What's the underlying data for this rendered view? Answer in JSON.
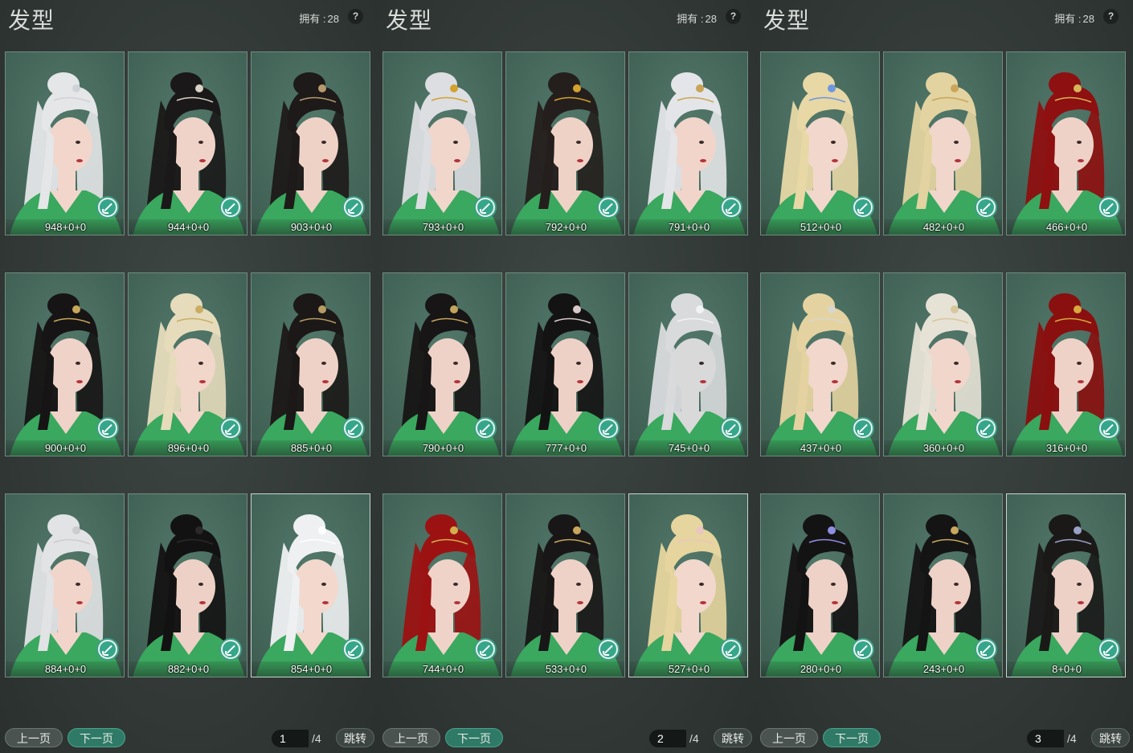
{
  "panels": [
    {
      "title": "发型",
      "owned_label": "拥有 :",
      "owned_count": "28",
      "help": "?",
      "prev_label": "上一页",
      "next_label": "下一页",
      "page": "1",
      "total": "/4",
      "jump_label": "跳转",
      "cards": [
        {
          "price": "948+0+0",
          "hair": "#e4e6e8",
          "skin": "#f2d6cb",
          "accent": "#cfd3d6"
        },
        {
          "price": "944+0+0",
          "hair": "#1a1818",
          "skin": "#f0d3c8",
          "accent": "#d7d2c4"
        },
        {
          "price": "903+0+0",
          "hair": "#1d1a19",
          "skin": "#efd2c6",
          "accent": "#b49a6e"
        },
        {
          "price": "900+0+0",
          "hair": "#161414",
          "skin": "#efd3c8",
          "accent": "#c7a85a"
        },
        {
          "price": "896+0+0",
          "hair": "#e6dcbc",
          "skin": "#f1d6ca",
          "accent": "#c9ad66"
        },
        {
          "price": "885+0+0",
          "hair": "#1b1817",
          "skin": "#efd2c7",
          "accent": "#b69b62"
        },
        {
          "price": "884+0+0",
          "hair": "#e2e3e5",
          "skin": "#f1d5cb",
          "accent": "#cccccc"
        },
        {
          "price": "882+0+0",
          "hair": "#131212",
          "skin": "#eed1c6",
          "accent": "#2b2928"
        },
        {
          "price": "854+0+0",
          "hair": "#eef0f2",
          "skin": "#f2d8cd",
          "accent": "#ffffff",
          "selected": true
        }
      ]
    },
    {
      "title": "发型",
      "owned_label": "拥有 :",
      "owned_count": "28",
      "help": "?",
      "prev_label": "上一页",
      "next_label": "下一页",
      "page": "2",
      "total": "/4",
      "jump_label": "跳转",
      "cards": [
        {
          "price": "793+0+0",
          "hair": "#dcdee2",
          "skin": "#f1d6cc",
          "accent": "#d3a12e"
        },
        {
          "price": "792+0+0",
          "hair": "#241f1d",
          "skin": "#efd2c6",
          "accent": "#d3a12e"
        },
        {
          "price": "791+0+0",
          "hair": "#e3e5e8",
          "skin": "#f1d5ca",
          "accent": "#c8a457"
        },
        {
          "price": "790+0+0",
          "hair": "#171515",
          "skin": "#efd2c7",
          "accent": "#c4a35c"
        },
        {
          "price": "777+0+0",
          "hair": "#141313",
          "skin": "#eed1c6",
          "accent": "#d8c8c8"
        },
        {
          "price": "745+0+0",
          "hair": "#d8dadc",
          "skin": "#d9d9da",
          "accent": "#f2f3f4"
        },
        {
          "price": "744+0+0",
          "hair": "#9c1212",
          "skin": "#f0d3c8",
          "accent": "#d3ae4c"
        },
        {
          "price": "533+0+0",
          "hair": "#181616",
          "skin": "#efd2c7",
          "accent": "#c8a65c"
        },
        {
          "price": "527+0+0",
          "hair": "#e6d59e",
          "skin": "#f2d7cc",
          "accent": "#e9c6c2",
          "selected": true
        }
      ]
    },
    {
      "title": "发型",
      "owned_label": "拥有 :",
      "owned_count": "28",
      "help": "?",
      "prev_label": "上一页",
      "next_label": "下一页",
      "page": "3",
      "total": "/4",
      "jump_label": "跳转",
      "cards": [
        {
          "price": "512+0+0",
          "hair": "#e8d8a6",
          "skin": "#f2d7cc",
          "accent": "#6f97e0"
        },
        {
          "price": "482+0+0",
          "hair": "#e2d3a0",
          "skin": "#f1d6cb",
          "accent": "#c9a65a"
        },
        {
          "price": "466+0+0",
          "hair": "#8e1010",
          "skin": "#efd2c7",
          "accent": "#d7b45a"
        },
        {
          "price": "437+0+0",
          "hair": "#e4d3a0",
          "skin": "#f2d7cc",
          "accent": "#d9d6cf"
        },
        {
          "price": "360+0+0",
          "hair": "#e7e2d6",
          "skin": "#f1d6cb",
          "accent": "#d8c79a"
        },
        {
          "price": "316+0+0",
          "hair": "#8a0f0f",
          "skin": "#efd2c7",
          "accent": "#d9a83f"
        },
        {
          "price": "280+0+0",
          "hair": "#141313",
          "skin": "#efd2c7",
          "accent": "#8d8fe0"
        },
        {
          "price": "243+0+0",
          "hair": "#151414",
          "skin": "#efd2c7",
          "accent": "#c7a85e"
        },
        {
          "price": "8+0+0",
          "hair": "#1a1918",
          "skin": "#eed1c6",
          "accent": "#9aa0c6",
          "selected": true
        }
      ]
    }
  ]
}
